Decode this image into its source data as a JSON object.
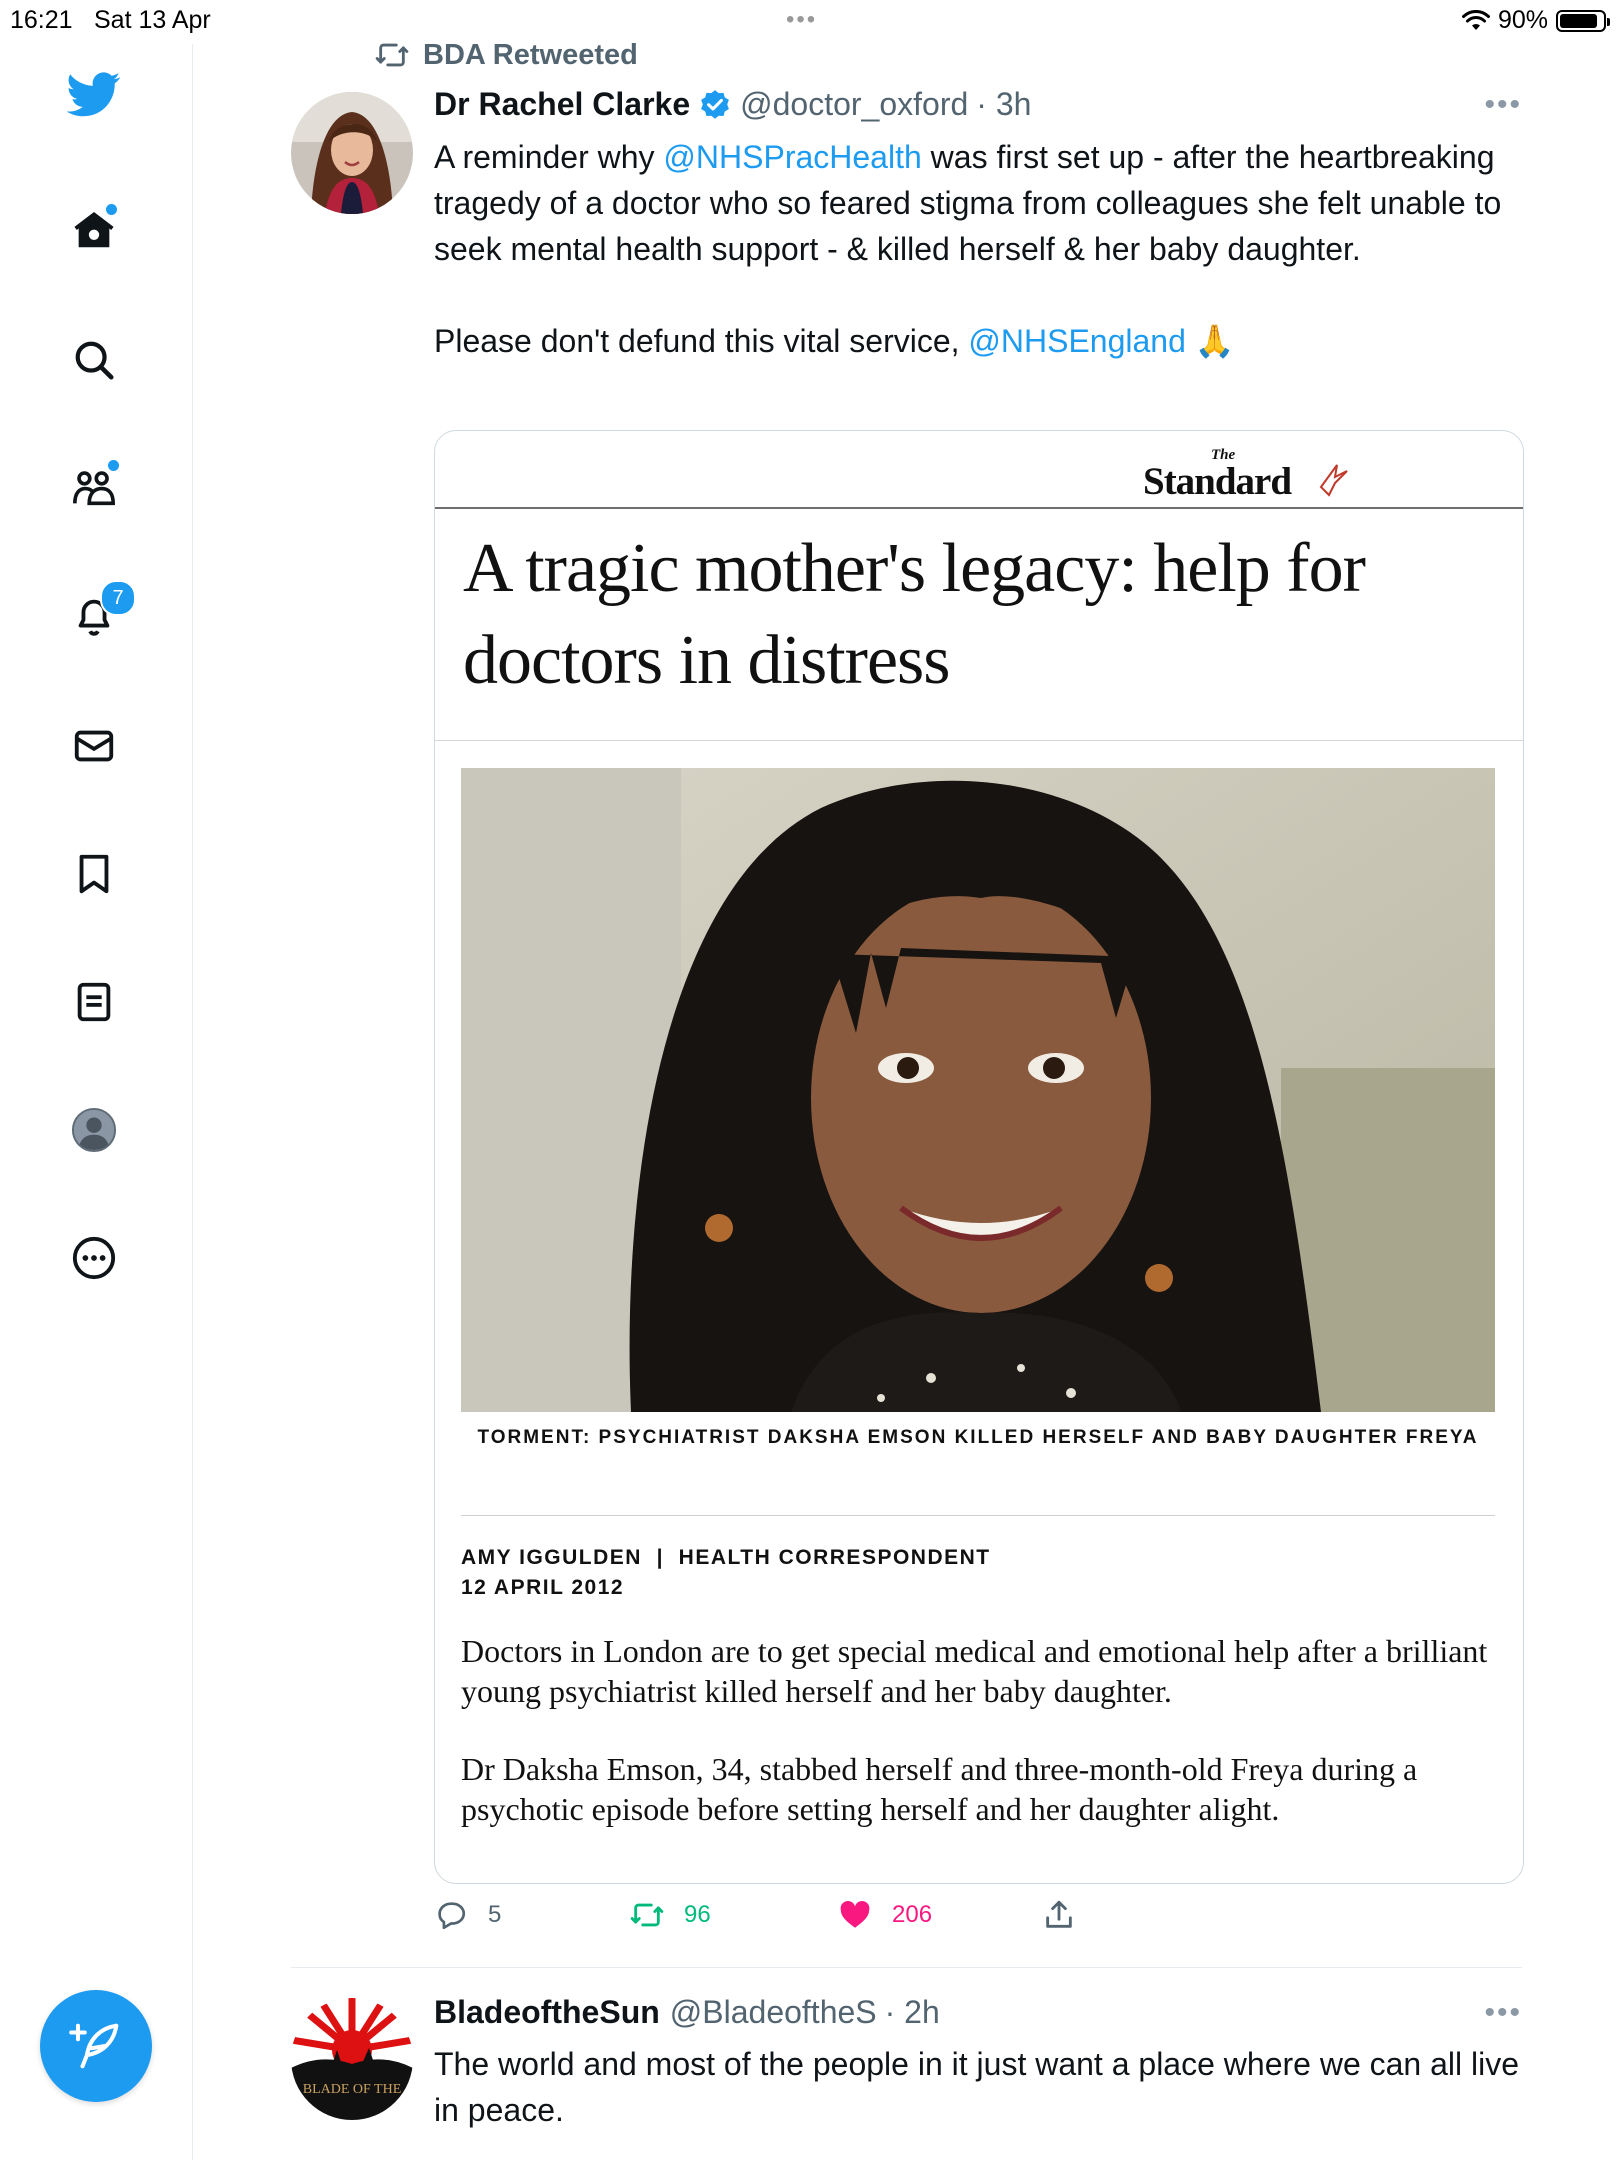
{
  "status_bar": {
    "time": "16:21",
    "date": "Sat 13 Apr",
    "battery": "90%",
    "battery_level": 0.9
  },
  "sidebar": {
    "items": [
      {
        "name": "home",
        "icon": "home-icon",
        "badge": "dot"
      },
      {
        "name": "explore",
        "icon": "search-icon"
      },
      {
        "name": "communities",
        "icon": "people-icon",
        "badge": "dot"
      },
      {
        "name": "notifications",
        "icon": "bell-icon",
        "badge": "7"
      },
      {
        "name": "messages",
        "icon": "envelope-icon"
      },
      {
        "name": "bookmarks",
        "icon": "bookmark-icon"
      },
      {
        "name": "lists",
        "icon": "list-icon"
      },
      {
        "name": "profile",
        "icon": "profile-avatar-icon"
      },
      {
        "name": "more",
        "icon": "more-circle-icon"
      }
    ],
    "compose_icon": "feather-plus-icon"
  },
  "tweet": {
    "retweeted_by": "BDA Retweeted",
    "author_name": "Dr Rachel Clarke",
    "handle": "@doctor_oxford",
    "time": "· 3h",
    "text_parts": {
      "p1_a": "A reminder why ",
      "p1_link": "@NHSPracHealth",
      "p1_b": " was first set up - after the heartbreaking tragedy of a doctor who so feared stigma from colleagues she felt unable to seek mental health support - & killed herself & her baby daughter.",
      "p2_a": "Please don't defund this vital service, ",
      "p2_link": "@NHSEngland",
      "p2_emoji": "🙏"
    },
    "card": {
      "publication_small": "The",
      "publication": "Standard",
      "headline": "A tragic mother's legacy: help for doctors in distress",
      "caption": "TORMENT: PSYCHIATRIST DAKSHA EMSON KILLED HERSELF AND BABY DAUGHTER FREYA",
      "byline": "AMY IGGULDEN  |  HEALTH CORRESPONDENT",
      "date": "12 APRIL 2012",
      "paragraph1": "Doctors in London are to get special medical and emotional help after a brilliant young psychiatrist killed herself and her baby daughter.",
      "paragraph2": "Dr Daksha Emson, 34, stabbed herself and three-month-old Freya during a psychotic episode before setting herself and her daughter alight."
    },
    "actions": {
      "replies": "5",
      "retweets": "96",
      "likes": "206"
    }
  },
  "tweet2": {
    "author_name": "BladeoftheSun",
    "handle": "@BladeoftheS",
    "time": "· 2h",
    "avatar_text": "BLADE OF THE",
    "text": "The world and most of the people in it just want a place where we can all live in peace."
  },
  "colors": {
    "accent": "#1d9bf0",
    "like": "#f91880",
    "retweet": "#00ba7c",
    "muted": "#536471"
  }
}
